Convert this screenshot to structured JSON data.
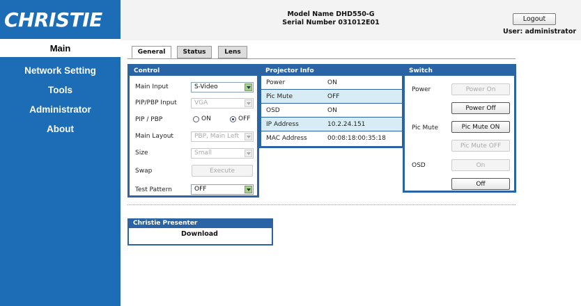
{
  "logo": "CHRISTIE",
  "sidebar": {
    "active": "Main",
    "items": [
      "Network Setting",
      "Tools",
      "Administrator",
      "About"
    ]
  },
  "header": {
    "model_name": "Model Name DHD550-G",
    "serial_number": "Serial Number 031012E01",
    "logout_label": "Logout",
    "user": "User: administrator"
  },
  "tabs": [
    "General",
    "Status",
    "Lens"
  ],
  "control": {
    "title": "Control",
    "main_input_label": "Main Input",
    "main_input_value": "S-Video",
    "pip_pbp_input_label": "PIP/PBP Input",
    "pip_pbp_input_value": "VGA",
    "pip_pbp_label": "PIP / PBP",
    "on_label": "ON",
    "off_label": "OFF",
    "pip_pbp_selected": "OFF",
    "main_layout_label": "Main Layout",
    "main_layout_value": "PBP, Main Left",
    "size_label": "Size",
    "size_value": "Small",
    "swap_label": "Swap",
    "execute_label": "Execute",
    "test_pattern_label": "Test Pattern",
    "test_pattern_value": "OFF"
  },
  "projector_info": {
    "title": "Projector Info",
    "rows": [
      {
        "key": "Power",
        "value": "ON"
      },
      {
        "key": "Pic Mute",
        "value": "OFF"
      },
      {
        "key": "OSD",
        "value": "ON"
      },
      {
        "key": "IP Address",
        "value": "10.2.24.151"
      },
      {
        "key": "MAC Address",
        "value": "00:08:18:00:35:18"
      }
    ]
  },
  "switch": {
    "title": "Switch",
    "power_label": "Power",
    "power_on": "Power On",
    "power_off": "Power Off",
    "pic_mute_label": "Pic Mute",
    "pic_mute_on": "Pic Mute ON",
    "pic_mute_off": "Pic Mute OFF",
    "osd_label": "OSD",
    "osd_on": "On",
    "osd_off": "Off"
  },
  "presenter": {
    "title": "Christie Presenter",
    "download_label": "Download"
  },
  "colors": {
    "brand_blue": "#1c6cb6",
    "panel_blue": "#2a64a4",
    "row_highlight": "#d7ecf5",
    "select_arrow": "#a8d08d"
  }
}
